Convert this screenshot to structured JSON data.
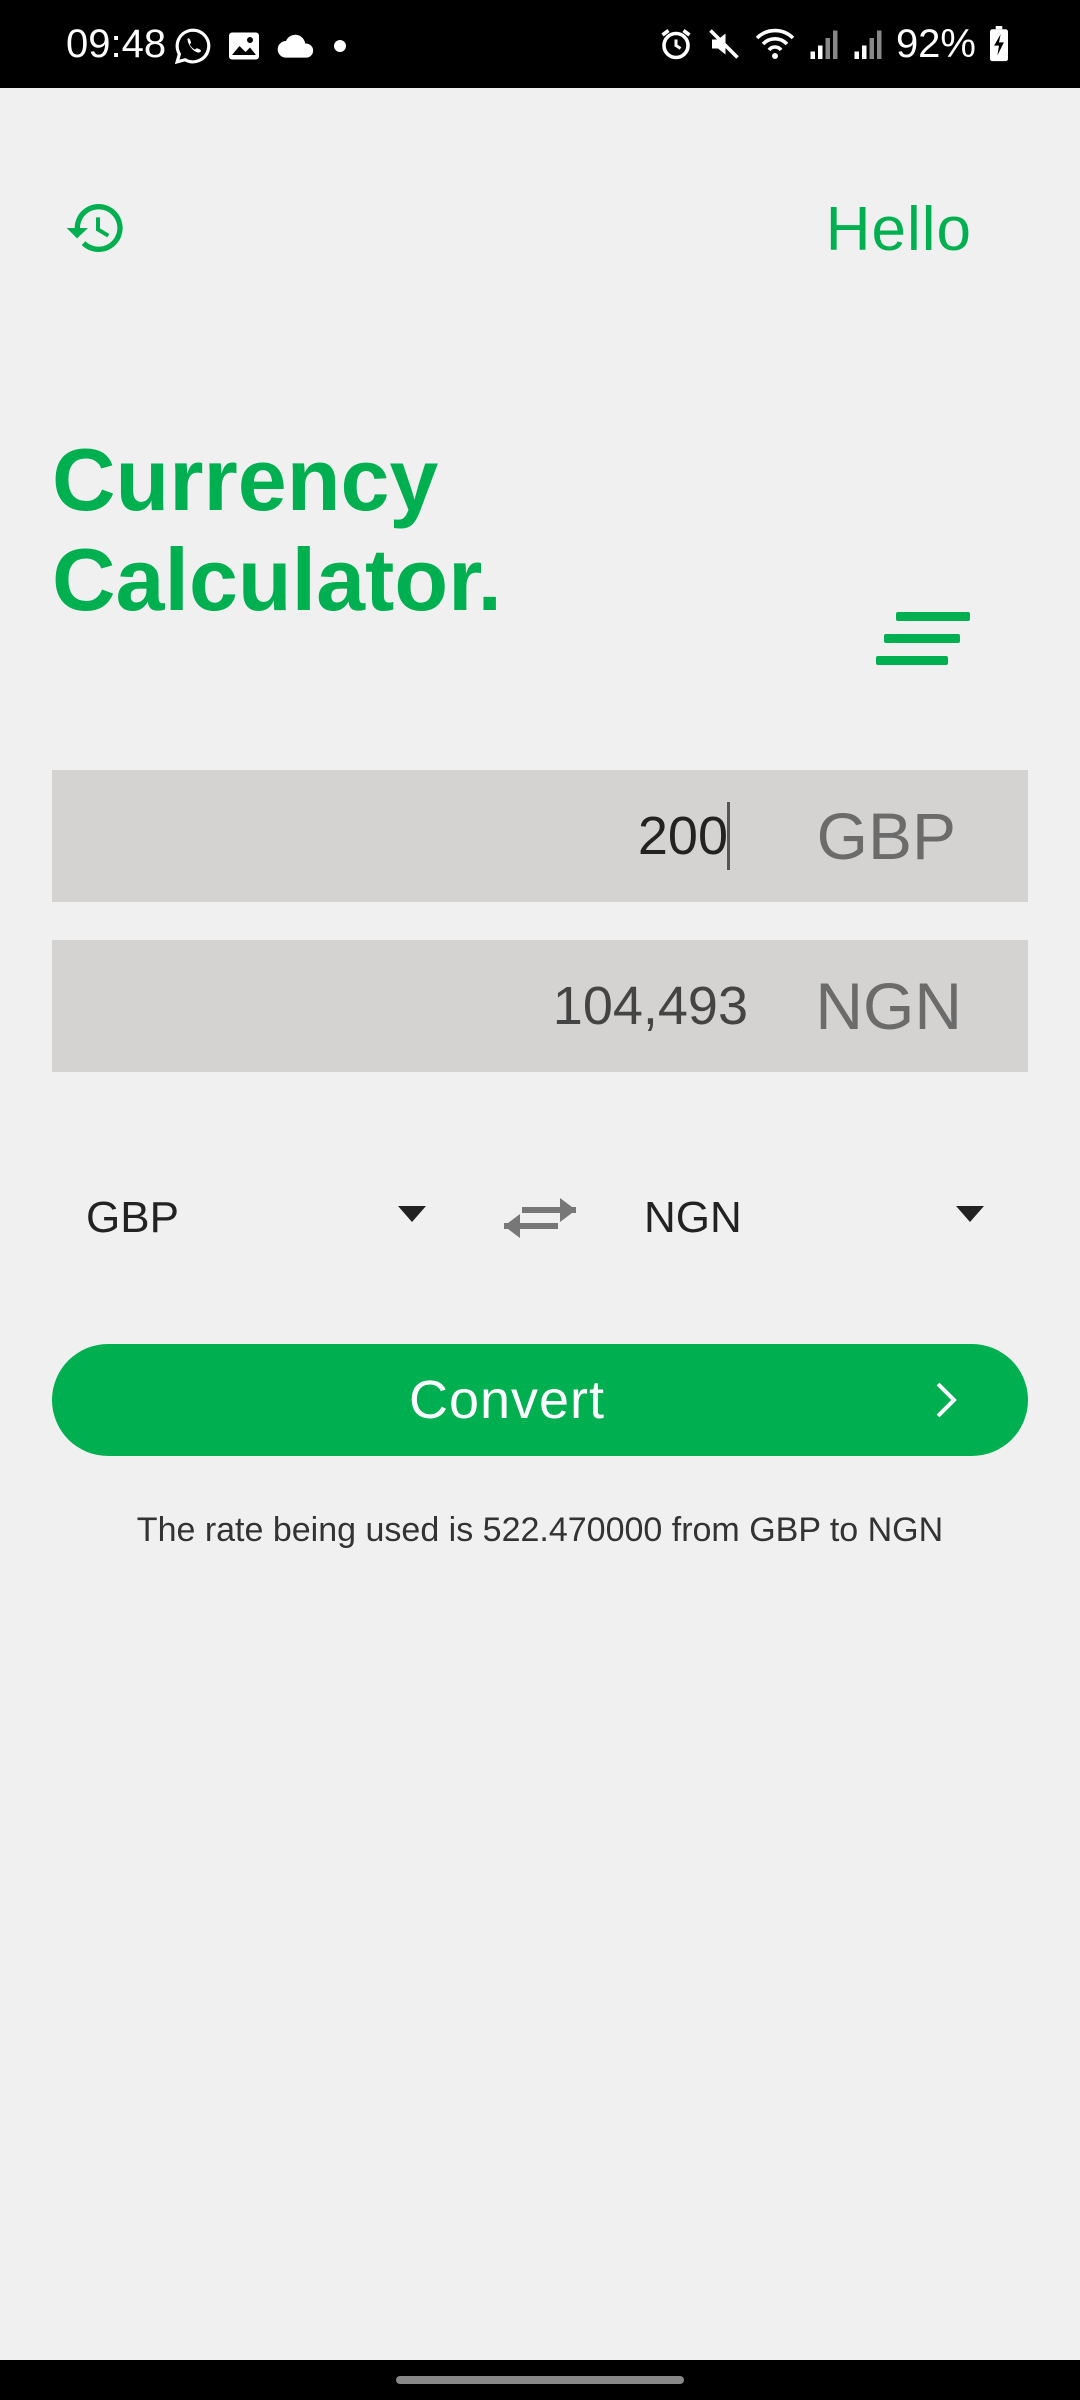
{
  "status_bar": {
    "time": "09:48",
    "battery": "92%",
    "left_icons": [
      "whatsapp-icon",
      "gallery-icon",
      "cloud-icon",
      "dot-icon"
    ],
    "right_icons": [
      "alarm-icon",
      "mute-icon",
      "wifi-icon",
      "signal-icon",
      "signal-icon",
      "battery-charging-icon"
    ]
  },
  "header": {
    "history_icon": "history-icon",
    "greeting": "Hello"
  },
  "title": {
    "line1": "Currency",
    "line2": "Calculator."
  },
  "menu_icon": "sort-lines-icon",
  "amount_from": {
    "value": "200",
    "currency": "GBP"
  },
  "amount_to": {
    "value": "104,493",
    "currency": "NGN"
  },
  "selectors": {
    "from": "GBP",
    "to": "NGN",
    "swap_icon": "swap-arrows-icon"
  },
  "convert_button": {
    "label": "Convert",
    "icon": "chevron-right-icon"
  },
  "rate_text": "The rate being used is 522.470000 from GBP to NGN",
  "colors": {
    "accent": "#00b050",
    "field_background": "#d4d3d1",
    "page_background": "#f0f0f0"
  }
}
